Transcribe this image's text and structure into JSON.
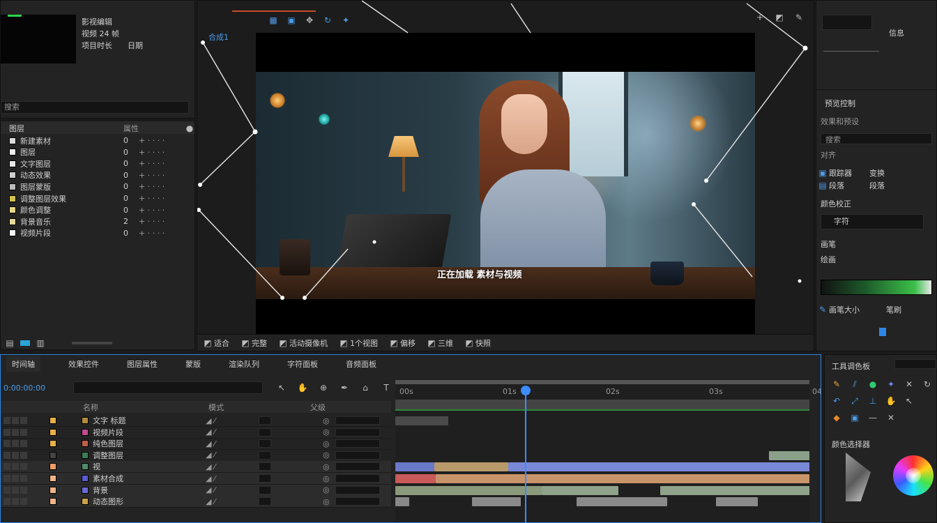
{
  "project": {
    "meta_lines": [
      "影视编辑",
      "视频 24 帧",
      "项目时长"
    ],
    "meta_right": [
      "日期",
      "时长"
    ],
    "search_value": "搜索"
  },
  "layers_panel": {
    "header": "图层",
    "header_cols": "属性",
    "items": [
      {
        "name": "新建素材",
        "color": "#dcdcdc",
        "val": "0"
      },
      {
        "name": "图层",
        "color": "#f0f0f0",
        "val": "0"
      },
      {
        "name": "文字图层",
        "color": "#e8e8e8",
        "val": "0"
      },
      {
        "name": "动态效果",
        "color": "#cfcfcf",
        "val": "0"
      },
      {
        "name": "图层蒙版",
        "color": "#bbbbbb",
        "val": "0"
      },
      {
        "name": "调整图层效果",
        "color": "#d2c24a",
        "val": "0"
      },
      {
        "name": "颜色调整",
        "color": "#e8d78a",
        "val": "0"
      },
      {
        "name": "背景音乐",
        "color": "#e8da9b",
        "val": "2"
      },
      {
        "name": "视频片段",
        "color": "#f5f5f5",
        "val": "0"
      }
    ]
  },
  "composition": {
    "tab_label": "合成1",
    "subtitle": "正在加载 素材与视频",
    "top_toolbar": [
      "适合",
      "完整",
      "活动摄像机"
    ],
    "bottom_toolbar": [
      "适合",
      "完整",
      "活动摄像机",
      "1个视图",
      "偏移",
      "三维",
      "快照"
    ]
  },
  "right_panel": {
    "info_line": "信息",
    "preview_label": "预览控制",
    "effects_label": "效果和预设",
    "search_placeholder": "搜索",
    "align_label": "对齐",
    "tracker_label": "跟踪器",
    "tracker_right": "变换",
    "paragraph_label": "段落",
    "paragraph_right": "段落",
    "color_label": "颜色校正",
    "char_label": "字符",
    "brush_label": "画笔",
    "brush_right": "笔刷",
    "paint_label": "绘画",
    "size_label": "画笔大小",
    "tool_label": "工具调色板",
    "color_wheel_label": "颜色选择器"
  },
  "timeline": {
    "tabs": [
      "时间轴",
      "效果控件",
      "图层属性",
      "蒙版",
      "渲染队列",
      "字符面板",
      "音频面板"
    ],
    "timecode": "0:00:00:00",
    "search_placeholder": "",
    "header_cols": [
      "名称",
      "模式",
      "父级"
    ],
    "ruler_labels": [
      "00s",
      "01s",
      "02s",
      "03s",
      "04s"
    ],
    "layers": [
      {
        "name": "文字 标题",
        "color": "#e8b04a",
        "icon_color": "#b38a3c"
      },
      {
        "name": "视频片段",
        "color": "#e8b04a",
        "icon_color": "#c04b8e"
      },
      {
        "name": "纯色图层",
        "color": "#e8b04a",
        "icon_color": "#c25c4a"
      },
      {
        "name": "调整图层",
        "color": "#444444",
        "icon_color": "#3c7d55"
      },
      {
        "name": "视",
        "color": "#f09b6a",
        "icon_color": "#4f8a6a"
      },
      {
        "name": "素材合成",
        "color": "#f0b48a",
        "icon_color": "#5a5ad0"
      },
      {
        "name": "背景",
        "color": "#f0b48a",
        "icon_color": "#6a6ad8"
      },
      {
        "name": "动态图形",
        "color": "#f0b48a",
        "icon_color": "#c9a24a"
      }
    ]
  },
  "colors": {
    "accent_blue": "#2e86e8",
    "playhead": "#3d8bff",
    "green_bar": "#2a8a3a"
  },
  "icons": [
    "selection-tool-icon",
    "hand-tool-icon",
    "zoom-tool-icon",
    "pen-tool-icon",
    "text-tool-icon",
    "brush-tool-icon",
    "puppet-tool-icon",
    "camera-icon",
    "snapshot-icon"
  ]
}
